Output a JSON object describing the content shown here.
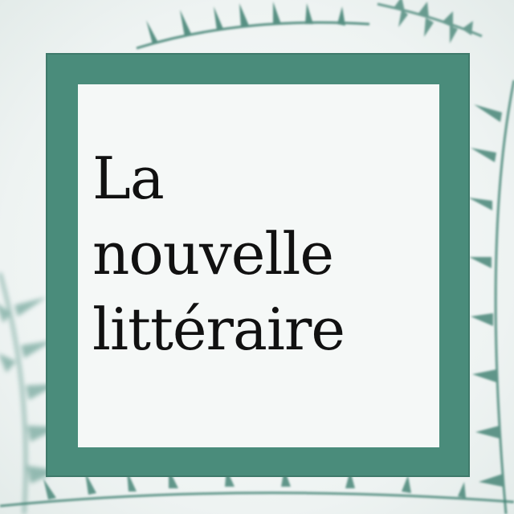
{
  "title": {
    "lines": [
      "La",
      "nouvelle",
      "littéraire"
    ]
  },
  "colors": {
    "frame": "#4a8c7b",
    "inner_background": "#f5f8f7",
    "text": "#111111",
    "fern": "#3d7f70"
  },
  "icons": {
    "decoration": "fern-leaves-icon"
  }
}
